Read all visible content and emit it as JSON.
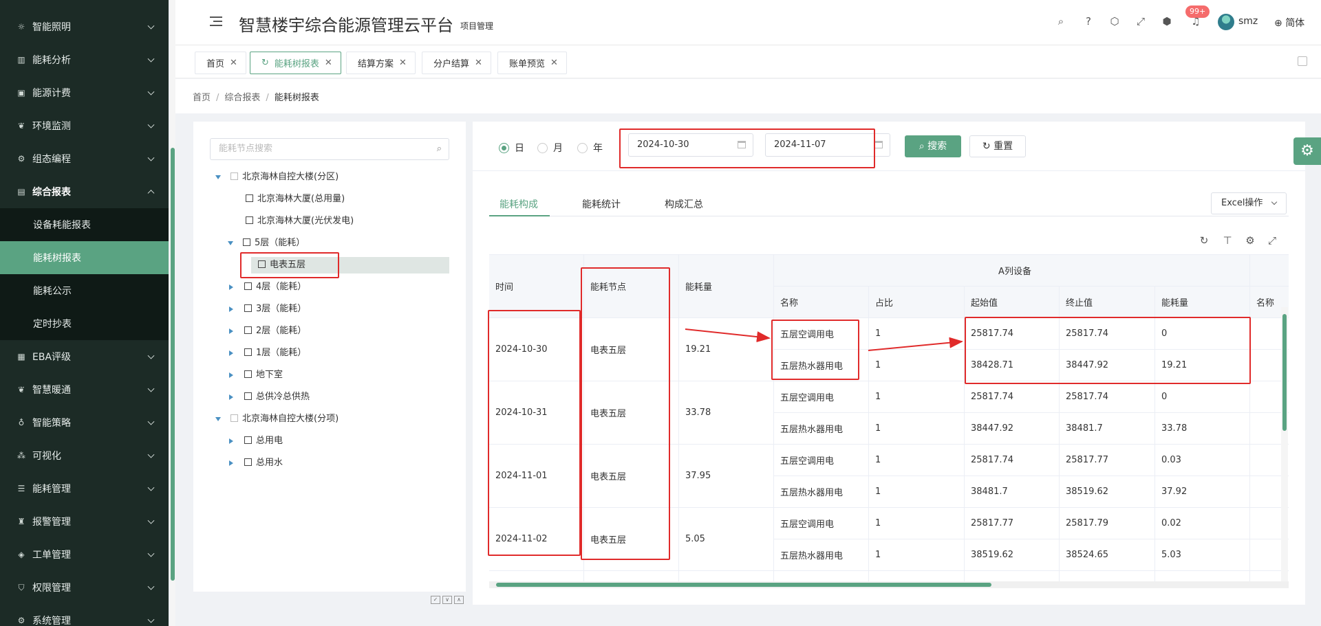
{
  "header": {
    "title": "智慧楼宇综合能源管理云平台",
    "subtitle": "项目管理",
    "badge": "99+",
    "username": "smz",
    "language": "简体"
  },
  "sidebar": {
    "items": [
      {
        "label": "智能照明"
      },
      {
        "label": "能耗分析"
      },
      {
        "label": "能源计费"
      },
      {
        "label": "环境监测"
      },
      {
        "label": "组态编程"
      },
      {
        "label": "综合报表"
      },
      {
        "label": "EBA评级"
      },
      {
        "label": "智慧暖通"
      },
      {
        "label": "智能策略"
      },
      {
        "label": "可视化"
      },
      {
        "label": "能耗管理"
      },
      {
        "label": "报警管理"
      },
      {
        "label": "工单管理"
      },
      {
        "label": "权限管理"
      },
      {
        "label": "系统管理"
      }
    ],
    "submenu": [
      {
        "label": "设备耗能报表"
      },
      {
        "label": "能耗树报表"
      },
      {
        "label": "能耗公示"
      },
      {
        "label": "定时抄表"
      }
    ]
  },
  "tabs": [
    {
      "label": "首页"
    },
    {
      "label": "能耗树报表"
    },
    {
      "label": "结算方案"
    },
    {
      "label": "分户结算"
    },
    {
      "label": "账单预览"
    }
  ],
  "breadcrumb": {
    "home": "首页",
    "parent": "综合报表",
    "current": "能耗树报表"
  },
  "tree": {
    "search_placeholder": "能耗节点搜索",
    "nodes": [
      {
        "label": "北京海林自控大楼(分区)"
      },
      {
        "label": "北京海林大厦(总用量)"
      },
      {
        "label": "北京海林大厦(光伏发电)"
      },
      {
        "label": "5层（能耗）"
      },
      {
        "label": "电表五层"
      },
      {
        "label": "4层（能耗）"
      },
      {
        "label": "3层（能耗）"
      },
      {
        "label": "2层（能耗）"
      },
      {
        "label": "1层（能耗）"
      },
      {
        "label": "地下室"
      },
      {
        "label": "总供冷总供热"
      },
      {
        "label": "北京海林自控大楼(分项)"
      },
      {
        "label": "总用电"
      },
      {
        "label": "总用水"
      }
    ]
  },
  "filters": {
    "day": "日",
    "month": "月",
    "year": "年",
    "start_date": "2024-10-30",
    "end_date": "2024-11-07",
    "search": "搜索",
    "reset": "重置"
  },
  "subtabs": [
    {
      "label": "能耗构成"
    },
    {
      "label": "能耗统计"
    },
    {
      "label": "构成汇总"
    }
  ],
  "excel_label": "Excel操作",
  "table": {
    "headers": {
      "time": "时间",
      "node": "能耗节点",
      "consumption": "能耗量",
      "group": "A列设备",
      "name": "名称",
      "ratio": "占比",
      "start": "起始值",
      "end": "终止值",
      "amount": "能耗量",
      "name2": "名称"
    },
    "rows": [
      {
        "time": "2024-10-30",
        "node": "电表五层",
        "consumption": "19.21",
        "devices": [
          {
            "name": "五层空调用电",
            "ratio": "1",
            "start": "25817.74",
            "end": "25817.74",
            "amount": "0"
          },
          {
            "name": "五层热水器用电",
            "ratio": "1",
            "start": "38428.71",
            "end": "38447.92",
            "amount": "19.21"
          }
        ]
      },
      {
        "time": "2024-10-31",
        "node": "电表五层",
        "consumption": "33.78",
        "devices": [
          {
            "name": "五层空调用电",
            "ratio": "1",
            "start": "25817.74",
            "end": "25817.74",
            "amount": "0"
          },
          {
            "name": "五层热水器用电",
            "ratio": "1",
            "start": "38447.92",
            "end": "38481.7",
            "amount": "33.78"
          }
        ]
      },
      {
        "time": "2024-11-01",
        "node": "电表五层",
        "consumption": "37.95",
        "devices": [
          {
            "name": "五层空调用电",
            "ratio": "1",
            "start": "25817.74",
            "end": "25817.77",
            "amount": "0.03"
          },
          {
            "name": "五层热水器用电",
            "ratio": "1",
            "start": "38481.7",
            "end": "38519.62",
            "amount": "37.92"
          }
        ]
      },
      {
        "time": "2024-11-02",
        "node": "电表五层",
        "consumption": "5.05",
        "devices": [
          {
            "name": "五层空调用电",
            "ratio": "1",
            "start": "25817.77",
            "end": "25817.79",
            "amount": "0.02"
          },
          {
            "name": "五层热水器用电",
            "ratio": "1",
            "start": "38519.62",
            "end": "38524.65",
            "amount": "5.03"
          }
        ]
      }
    ]
  },
  "colors": {
    "accent": "#5aa382",
    "sidebar": "#1c2b26",
    "annotation": "#e02a2a"
  }
}
